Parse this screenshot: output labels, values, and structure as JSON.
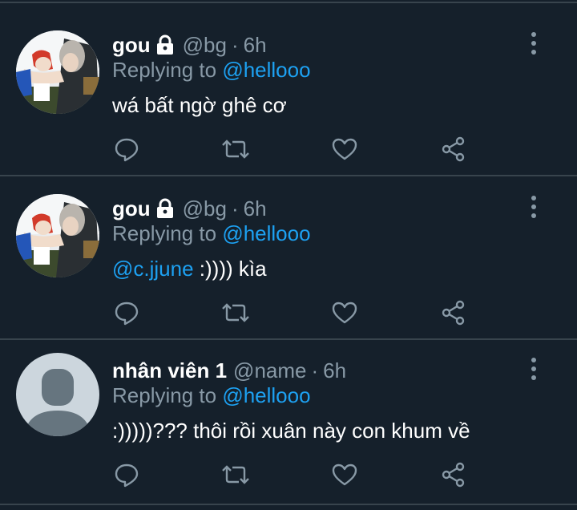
{
  "colors": {
    "background": "#15202b",
    "name": "#ffffff",
    "muted": "#8899a6",
    "link": "#1da1f2",
    "divider": "#38444d"
  },
  "tweets": [
    {
      "name": "gou",
      "protected": true,
      "handle": "@bg",
      "separator": "·",
      "time": "6h",
      "replying_prefix": "Replying to ",
      "replying_to": "@hellooo",
      "text_mention": "",
      "text": "wá bất ngờ ghê cơ",
      "avatar": "anime-illustration"
    },
    {
      "name": "gou",
      "protected": true,
      "handle": "@bg",
      "separator": "·",
      "time": "6h",
      "replying_prefix": "Replying to ",
      "replying_to": "@hellooo",
      "text_mention": "@c.jjune",
      "text": " :)))) kìa",
      "avatar": "anime-illustration"
    },
    {
      "name": "nhân viên 1",
      "protected": false,
      "handle": "@name",
      "separator": "·",
      "time": "6h",
      "replying_prefix": "Replying to ",
      "replying_to": "@hellooo",
      "text_mention": "",
      "text": ":)))))??? thôi rồi xuân này con khum về",
      "avatar": "default-person"
    }
  ],
  "icons": {
    "lock": "lock-icon",
    "more": "more-vertical-icon",
    "reply": "reply-icon",
    "retweet": "retweet-icon",
    "like": "heart-icon",
    "share": "share-icon"
  }
}
